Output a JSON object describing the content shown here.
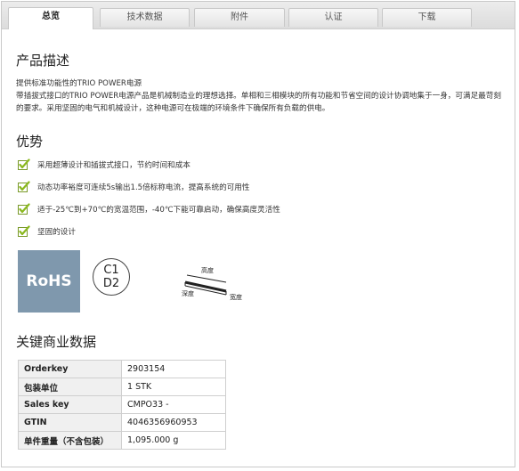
{
  "tabs": [
    "总览",
    "技术数据",
    "附件",
    "认证",
    "下载"
  ],
  "description": {
    "heading": "产品描述",
    "line1": "提供标准功能性的TRIO POWER电源",
    "line2": "带插拔式接口的TRIO POWER电源产品是机械制造业的理想选择。单相和三相模块的所有功能和节省空间的设计协调地集于一身，可满足最苛刻的要求。采用坚固的电气和机械设计，这种电源可在极端的环境条件下确保所有负载的供电。"
  },
  "advantages": {
    "heading": "优势",
    "items": [
      "采用超薄设计和插拔式接口，节约时间和成本",
      "动态功率裕度可连续5s输出1.5倍标称电流，提高系统的可用性",
      "适于-25℃到+70℃的宽温范围，-40℃下能可靠启动，确保高度灵活性",
      "坚固的设计"
    ]
  },
  "logos": {
    "rohs": "RoHS",
    "cd_top": "C1",
    "cd_bottom": "D2",
    "dim_height": "高度",
    "dim_depth": "深度",
    "dim_width": "宽度"
  },
  "key_data": {
    "heading": "关键商业数据",
    "rows": [
      {
        "key": "Orderkey",
        "value": "2903154"
      },
      {
        "key": "包装单位",
        "value": "1 STK"
      },
      {
        "key": "Sales key",
        "value": "CMPO33 -"
      },
      {
        "key": "GTIN",
        "value": "4046356960953"
      },
      {
        "key": "单件重量（不含包装）",
        "value": "1,095.000 g"
      }
    ]
  },
  "colors": {
    "accent_check": "#8ab81e",
    "rohs_bg": "#7f98ad"
  }
}
